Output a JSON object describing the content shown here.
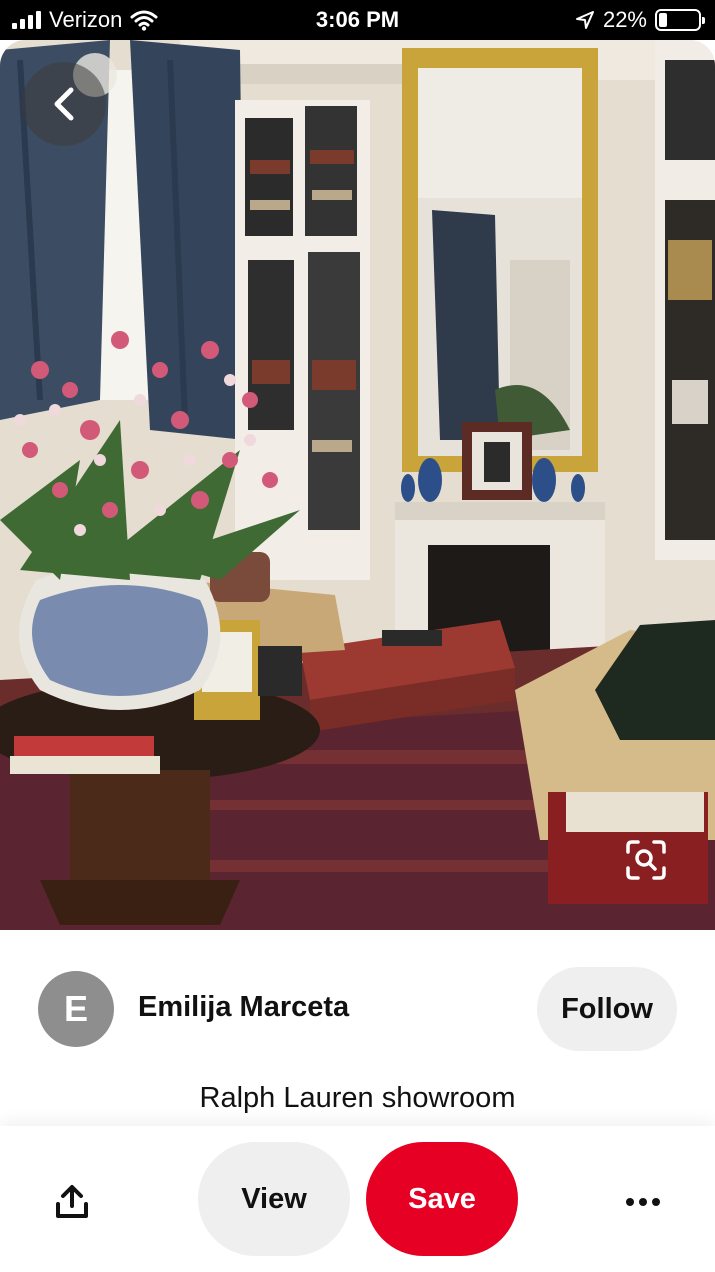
{
  "status_bar": {
    "carrier": "Verizon",
    "time": "3:06 PM",
    "battery_percent": "22%",
    "battery_level": 0.22,
    "icons": [
      "signal-bars-icon",
      "wifi-icon",
      "location-arrow-icon",
      "battery-icon"
    ]
  },
  "pin": {
    "image_description_icons": [
      "back-arrow-icon",
      "visual-search-icon"
    ],
    "title": "Ralph Lauren showroom"
  },
  "creator": {
    "avatar_initial": "E",
    "name": "Emilija Marceta",
    "follow_label": "Follow"
  },
  "actions": {
    "share_icon": "share-icon",
    "view_label": "View",
    "save_label": "Save",
    "more_icon": "more-dots-icon"
  },
  "colors": {
    "save_red": "#e60023",
    "pill_gray": "#efefef",
    "avatar_gray": "#8e8e8e"
  }
}
